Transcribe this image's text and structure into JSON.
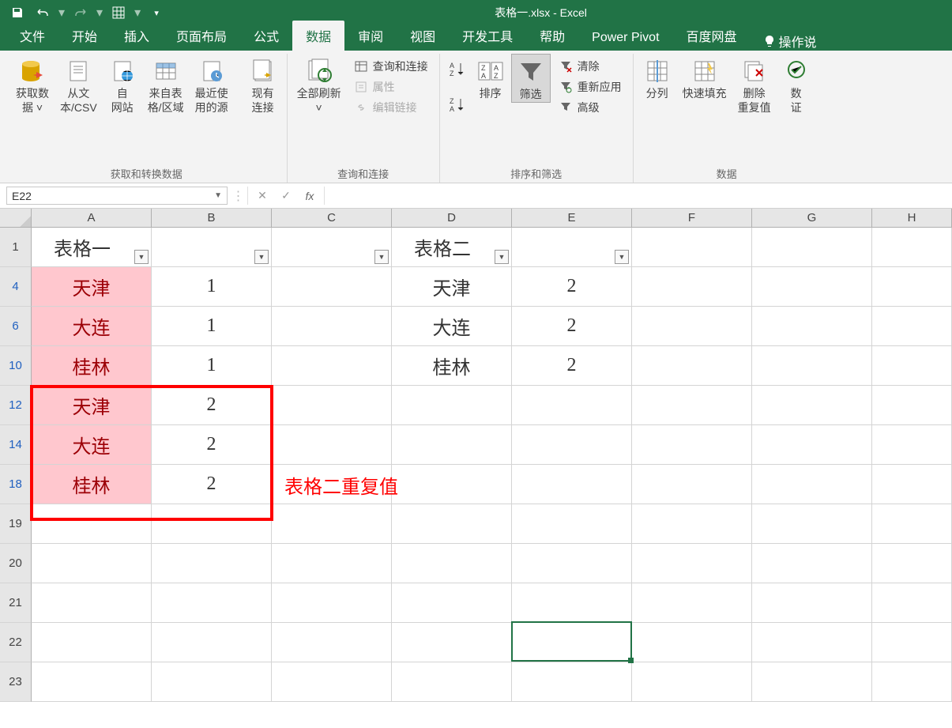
{
  "title": "表格一.xlsx - Excel",
  "tabs": [
    "文件",
    "开始",
    "插入",
    "页面布局",
    "公式",
    "数据",
    "审阅",
    "视图",
    "开发工具",
    "帮助",
    "Power Pivot",
    "百度网盘"
  ],
  "active_tab": "数据",
  "tell_me": "操作说",
  "ribbon": {
    "g1": {
      "label": "获取和转换数据",
      "items": [
        "获取数\n据 ˅",
        "从文\n本/CSV",
        "自\n网站",
        "来自表\n格/区域",
        "最近使\n用的源",
        "现有\n连接"
      ]
    },
    "g2": {
      "label": "查询和连接",
      "refresh": "全部刷新\n˅",
      "items": [
        "查询和连接",
        "属性",
        "编辑链接"
      ]
    },
    "g3": {
      "label": "排序和筛选",
      "sort_btns": [
        "排序",
        "筛选"
      ],
      "side": [
        "清除",
        "重新应用",
        "高级"
      ]
    },
    "g4": {
      "label": "数据",
      "items": [
        "分列",
        "快速填充",
        "删除\n重复值",
        "数\n证"
      ]
    }
  },
  "namebox": "E22",
  "fx": "",
  "columns": [
    "A",
    "B",
    "C",
    "D",
    "E",
    "F",
    "G",
    "H"
  ],
  "rows": [
    {
      "n": "1",
      "filtered": false,
      "cells": {
        "A": "表格一",
        "D": "表格二"
      },
      "filters": [
        "A",
        "B",
        "C",
        "D",
        "E"
      ]
    },
    {
      "n": "4",
      "filtered": true,
      "cells": {
        "A": "天津",
        "B": "1",
        "D": "天津",
        "E": "2"
      },
      "pinkA": true
    },
    {
      "n": "6",
      "filtered": true,
      "cells": {
        "A": "大连",
        "B": "1",
        "D": "大连",
        "E": "2"
      },
      "pinkA": true
    },
    {
      "n": "10",
      "filtered": true,
      "cells": {
        "A": "桂林",
        "B": "1",
        "D": "桂林",
        "E": "2"
      },
      "pinkA": true
    },
    {
      "n": "12",
      "filtered": true,
      "cells": {
        "A": "天津",
        "B": "2"
      },
      "pinkA": true
    },
    {
      "n": "14",
      "filtered": true,
      "cells": {
        "A": "大连",
        "B": "2"
      },
      "pinkA": true
    },
    {
      "n": "18",
      "filtered": true,
      "cells": {
        "A": "桂林",
        "B": "2"
      },
      "pinkA": true
    },
    {
      "n": "19",
      "filtered": false,
      "cells": {}
    },
    {
      "n": "20",
      "filtered": false,
      "cells": {}
    },
    {
      "n": "21",
      "filtered": false,
      "cells": {}
    },
    {
      "n": "22",
      "filtered": false,
      "cells": {}
    },
    {
      "n": "23",
      "filtered": false,
      "cells": {}
    }
  ],
  "annotation": "表格二重复值",
  "selected": {
    "col": "E",
    "row": "22"
  }
}
